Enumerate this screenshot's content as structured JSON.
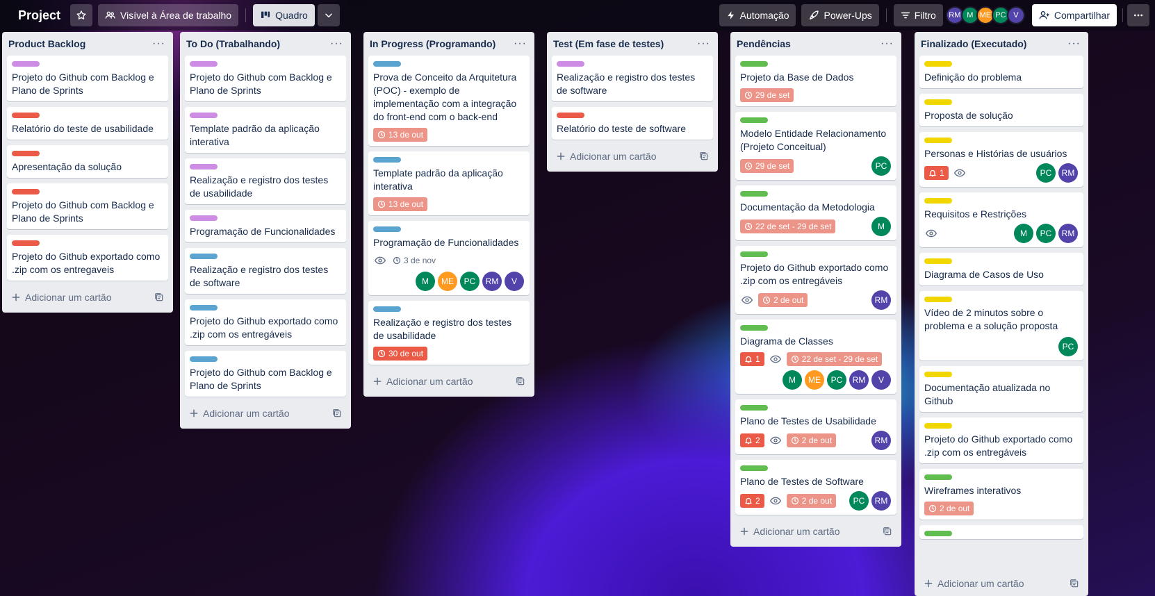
{
  "board": {
    "title": "Project",
    "visibility_label": "Visível à Área de trabalho",
    "view_label": "Quadro",
    "automation_label": "Automação",
    "powerups_label": "Power-Ups",
    "filter_label": "Filtro",
    "share_label": "Compartilhar",
    "members": [
      {
        "initials": "RM",
        "color": "#5243aa"
      },
      {
        "initials": "M",
        "color": "#00875a"
      },
      {
        "initials": "ME",
        "color": "#ff991f"
      },
      {
        "initials": "PC",
        "color": "#00875a"
      },
      {
        "initials": "V",
        "color": "#5243aa"
      }
    ]
  },
  "colors": {
    "purple": "#cd8de5",
    "red": "#eb5a46",
    "blue": "#5ba4cf",
    "green": "#61bd4f",
    "yellow": "#f2d600"
  },
  "add_card_label": "Adicionar um cartão",
  "lists": [
    {
      "title": "Product Backlog",
      "cards": [
        {
          "label": "purple",
          "title": "Projeto do Github com Backlog e Plano de Sprints"
        },
        {
          "label": "red",
          "title": "Relatório do teste de usabilidade"
        },
        {
          "label": "red",
          "title": "Apresentação da solução"
        },
        {
          "label": "red",
          "title": "Projeto do Github com Backlog e Plano de Sprints"
        },
        {
          "label": "red",
          "title": "Projeto do Github exportado como .zip com os entregaveis"
        }
      ]
    },
    {
      "title": "To Do (Trabalhando)",
      "cards": [
        {
          "label": "purple",
          "title": "Projeto do Github com Backlog e Plano de Sprints"
        },
        {
          "label": "purple",
          "title": "Template padrão da aplicação interativa"
        },
        {
          "label": "purple",
          "title": "Realização e registro dos testes de usabilidade"
        },
        {
          "label": "purple",
          "title": "Programação de Funcionalidades"
        },
        {
          "label": "blue",
          "title": "Realização e registro dos testes de software"
        },
        {
          "label": "blue",
          "title": "Projeto do Github exportado como .zip com os entregáveis"
        },
        {
          "label": "blue",
          "title": "Projeto do Github com Backlog e Plano de Sprints"
        }
      ]
    },
    {
      "title": "In Progress (Programando)",
      "cards": [
        {
          "label": "blue",
          "title": "Prova de Conceito da Arquitetura (POC) - exemplo de implementação com a integração do front-end com o back-end",
          "due": "13 de out",
          "due_style": "soft"
        },
        {
          "label": "blue",
          "title": "Template padrão da aplicação interativa",
          "due": "13 de out",
          "due_style": "soft"
        },
        {
          "label": "blue",
          "title": "Programação de Funcionalidades",
          "watch": true,
          "date_plain": "3 de nov",
          "members": [
            "M",
            "ME",
            "PC",
            "RM",
            "V"
          ]
        },
        {
          "label": "blue",
          "title": "Realização e registro dos testes de usabilidade",
          "due": "30 de out",
          "due_style": "hard"
        }
      ]
    },
    {
      "title": "Test (Em fase de testes)",
      "cards": [
        {
          "label": "purple",
          "title": "Realização e registro dos testes de software"
        },
        {
          "label": "red",
          "title": "Relatório do teste de software"
        }
      ]
    },
    {
      "title": "Pendências",
      "cards": [
        {
          "label": "green",
          "title": "Projeto da Base de Dados",
          "due": "29 de set",
          "due_style": "soft"
        },
        {
          "label": "green",
          "title": "Modelo Entidade Relacionamento (Projeto Conceitual)",
          "due": "29 de set",
          "due_style": "soft",
          "members": [
            "PC"
          ],
          "members_inline": true
        },
        {
          "label": "green",
          "title": "Documentação da Metodologia",
          "due": "22 de set - 29 de set",
          "due_style": "soft",
          "members": [
            "M"
          ],
          "members_inline": true
        },
        {
          "label": "green",
          "title": "Projeto do Github exportado como .zip com os entregáveis",
          "watch": true,
          "due": "2 de out",
          "due_style": "soft",
          "members": [
            "RM"
          ],
          "members_inline": true
        },
        {
          "label": "green",
          "title": "Diagrama de Classes",
          "notif": "1",
          "watch": true,
          "due": "22 de set - 29 de set",
          "due_style": "soft",
          "members": [
            "M",
            "ME",
            "PC",
            "RM",
            "V"
          ]
        },
        {
          "label": "green",
          "title": "Plano de Testes de Usabilidade",
          "notif": "2",
          "watch": true,
          "due": "2 de out",
          "due_style": "soft",
          "members": [
            "RM"
          ],
          "members_inline": true
        },
        {
          "label": "green",
          "title": "Plano de Testes de Software",
          "notif": "2",
          "watch": true,
          "due": "2 de out",
          "due_style": "soft",
          "members": [
            "PC",
            "RM"
          ],
          "members_inline": true
        }
      ]
    },
    {
      "title": "Finalizado (Executado)",
      "cards": [
        {
          "label": "yellow",
          "title": "Definição do problema"
        },
        {
          "label": "yellow",
          "title": "Proposta de solução"
        },
        {
          "label": "yellow",
          "title": "Personas e Histórias de usuários",
          "notif": "1",
          "watch": true,
          "members": [
            "PC",
            "RM"
          ],
          "members_inline": true
        },
        {
          "label": "yellow",
          "title": "Requisitos e Restrições",
          "watch": true,
          "members": [
            "M",
            "PC",
            "RM"
          ],
          "members_inline": true
        },
        {
          "label": "yellow",
          "title": "Diagrama de Casos de Uso"
        },
        {
          "label": "yellow",
          "title": "Vídeo de 2 minutos sobre o problema e a solução proposta",
          "members": [
            "PC"
          ]
        },
        {
          "label": "yellow",
          "title": "Documentação atualizada no Github"
        },
        {
          "label": "yellow",
          "title": "Projeto do Github exportado como .zip com os entregáveis"
        },
        {
          "label": "green",
          "title": "Wireframes interativos",
          "due": "2 de out",
          "due_style": "soft"
        },
        {
          "label": "green",
          "title": ""
        }
      ]
    }
  ]
}
